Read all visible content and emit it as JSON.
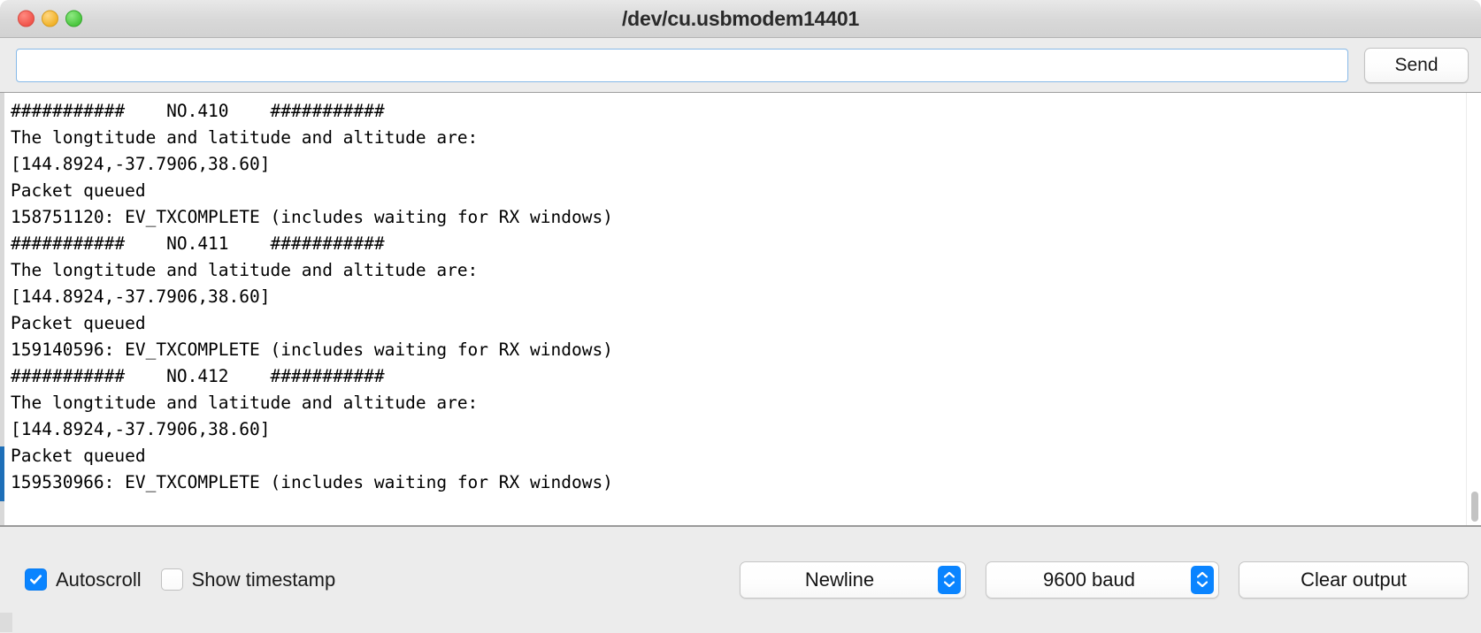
{
  "window": {
    "title": "/dev/cu.usbmodem14401",
    "traffic_lights": {
      "close": "close-button",
      "minimize": "minimize-button",
      "maximize": "maximize-button"
    }
  },
  "send_bar": {
    "input_value": "",
    "input_placeholder": "",
    "send_label": "Send"
  },
  "console": {
    "lines": [
      "###########    NO.410    ###########",
      "The longtitude and latitude and altitude are:",
      "[144.8924,-37.7906,38.60]",
      "Packet queued",
      "158751120: EV_TXCOMPLETE (includes waiting for RX windows)",
      "###########    NO.411    ###########",
      "The longtitude and latitude and altitude are:",
      "[144.8924,-37.7906,38.60]",
      "Packet queued",
      "159140596: EV_TXCOMPLETE (includes waiting for RX windows)",
      "###########    NO.412    ###########",
      "The longtitude and latitude and altitude are:",
      "[144.8924,-37.7906,38.60]",
      "Packet queued",
      "159530966: EV_TXCOMPLETE (includes waiting for RX windows)"
    ]
  },
  "bottom_bar": {
    "autoscroll": {
      "label": "Autoscroll",
      "checked": true
    },
    "show_timestamp": {
      "label": "Show timestamp",
      "checked": false
    },
    "line_ending": {
      "selected": "Newline"
    },
    "baud_rate": {
      "selected": "9600 baud"
    },
    "clear_output_label": "Clear output"
  },
  "colors": {
    "accent_blue": "#0a84ff",
    "focus_border": "#86b9e8",
    "scroll_marker": "#1e6fb8",
    "titlebar": "#d8d8d8",
    "toolbar": "#ececec"
  }
}
